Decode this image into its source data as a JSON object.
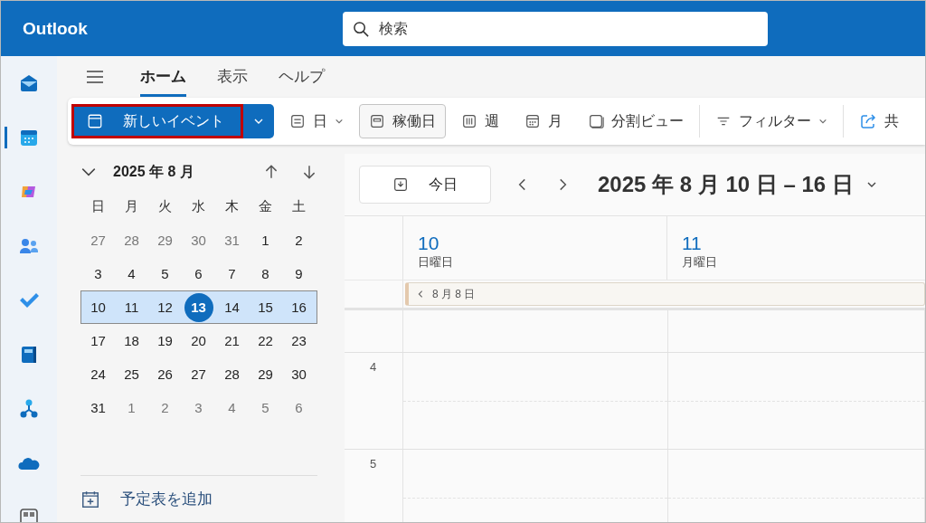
{
  "app": {
    "title": "Outlook"
  },
  "search": {
    "placeholder": "検索"
  },
  "rail": [
    {
      "kind": "mail",
      "selected": false
    },
    {
      "kind": "calendar",
      "selected": true
    },
    {
      "kind": "copilot",
      "selected": false
    },
    {
      "kind": "people",
      "selected": false
    },
    {
      "kind": "todo",
      "selected": false
    },
    {
      "kind": "book",
      "selected": false
    },
    {
      "kind": "org",
      "selected": false
    },
    {
      "kind": "cloud",
      "selected": false
    },
    {
      "kind": "apps",
      "selected": false
    }
  ],
  "tabs": [
    {
      "label": "ホーム",
      "selected": true
    },
    {
      "label": "表示",
      "selected": false
    },
    {
      "label": "ヘルプ",
      "selected": false
    }
  ],
  "new_event": {
    "label": "新しいイベント",
    "highlighted": true
  },
  "views": [
    {
      "kind": "day",
      "label": "日",
      "selected": false,
      "dropdown": true
    },
    {
      "kind": "workweek",
      "label": "稼働日",
      "selected": true,
      "dropdown": false
    },
    {
      "kind": "week",
      "label": "週",
      "selected": false,
      "dropdown": false
    },
    {
      "kind": "month",
      "label": "月",
      "selected": false,
      "dropdown": false
    },
    {
      "kind": "split",
      "label": "分割ビュー",
      "selected": false,
      "dropdown": false
    }
  ],
  "filter": {
    "label": "フィルター"
  },
  "share": {
    "label": "共"
  },
  "mini_calendar": {
    "title": "2025 年 8 月",
    "weekdays": [
      "日",
      "月",
      "火",
      "水",
      "木",
      "金",
      "土"
    ],
    "weeks": [
      {
        "selected": false,
        "days": [
          {
            "label": "27",
            "muted": true,
            "today": false
          },
          {
            "label": "28",
            "muted": true,
            "today": false
          },
          {
            "label": "29",
            "muted": true,
            "today": false
          },
          {
            "label": "30",
            "muted": true,
            "today": false
          },
          {
            "label": "31",
            "muted": true,
            "today": false
          },
          {
            "label": "1",
            "muted": false,
            "today": false
          },
          {
            "label": "2",
            "muted": false,
            "today": false
          }
        ]
      },
      {
        "selected": false,
        "days": [
          {
            "label": "3",
            "muted": false,
            "today": false
          },
          {
            "label": "4",
            "muted": false,
            "today": false
          },
          {
            "label": "5",
            "muted": false,
            "today": false
          },
          {
            "label": "6",
            "muted": false,
            "today": false
          },
          {
            "label": "7",
            "muted": false,
            "today": false
          },
          {
            "label": "8",
            "muted": false,
            "today": false
          },
          {
            "label": "9",
            "muted": false,
            "today": false
          }
        ]
      },
      {
        "selected": true,
        "days": [
          {
            "label": "10",
            "muted": false,
            "today": false
          },
          {
            "label": "11",
            "muted": false,
            "today": false
          },
          {
            "label": "12",
            "muted": false,
            "today": false
          },
          {
            "label": "13",
            "muted": false,
            "today": true
          },
          {
            "label": "14",
            "muted": false,
            "today": false
          },
          {
            "label": "15",
            "muted": false,
            "today": false
          },
          {
            "label": "16",
            "muted": false,
            "today": false
          }
        ]
      },
      {
        "selected": false,
        "days": [
          {
            "label": "17",
            "muted": false,
            "today": false
          },
          {
            "label": "18",
            "muted": false,
            "today": false
          },
          {
            "label": "19",
            "muted": false,
            "today": false
          },
          {
            "label": "20",
            "muted": false,
            "today": false
          },
          {
            "label": "21",
            "muted": false,
            "today": false
          },
          {
            "label": "22",
            "muted": false,
            "today": false
          },
          {
            "label": "23",
            "muted": false,
            "today": false
          }
        ]
      },
      {
        "selected": false,
        "days": [
          {
            "label": "24",
            "muted": false,
            "today": false
          },
          {
            "label": "25",
            "muted": false,
            "today": false
          },
          {
            "label": "26",
            "muted": false,
            "today": false
          },
          {
            "label": "27",
            "muted": false,
            "today": false
          },
          {
            "label": "28",
            "muted": false,
            "today": false
          },
          {
            "label": "29",
            "muted": false,
            "today": false
          },
          {
            "label": "30",
            "muted": false,
            "today": false
          }
        ]
      },
      {
        "selected": false,
        "days": [
          {
            "label": "31",
            "muted": false,
            "today": false
          },
          {
            "label": "1",
            "muted": true,
            "today": false
          },
          {
            "label": "2",
            "muted": true,
            "today": false
          },
          {
            "label": "3",
            "muted": true,
            "today": false
          },
          {
            "label": "4",
            "muted": true,
            "today": false
          },
          {
            "label": "5",
            "muted": true,
            "today": false
          },
          {
            "label": "6",
            "muted": true,
            "today": false
          }
        ]
      }
    ]
  },
  "add_calendar": {
    "label": "予定表を追加"
  },
  "today_button": {
    "label": "今日"
  },
  "range_title": "2025 年 8 月 10 日 – 16 日",
  "days": [
    {
      "number": "10",
      "weekday": "日曜日"
    },
    {
      "number": "11",
      "weekday": "月曜日"
    }
  ],
  "all_day_event": {
    "label": "8 月 8 日"
  },
  "hours": [
    "4",
    "5"
  ]
}
